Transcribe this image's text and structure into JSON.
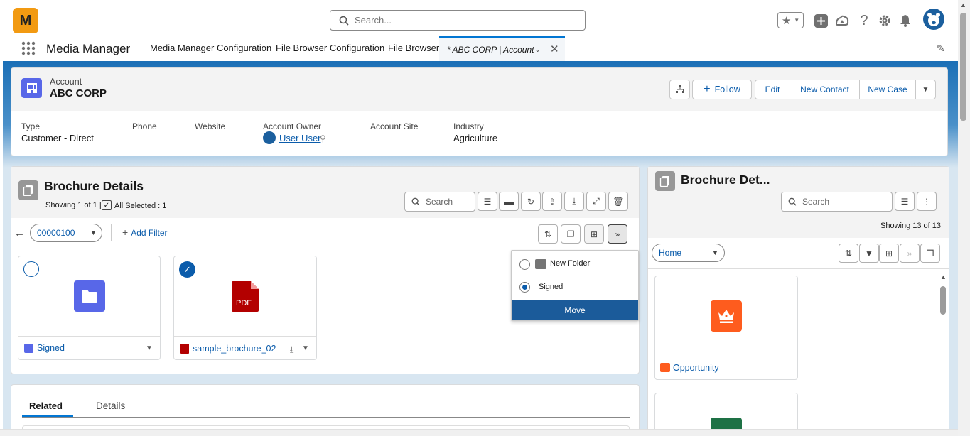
{
  "header": {
    "search_placeholder": "Search...",
    "logo_text": "M"
  },
  "nav": {
    "app_name": "Media Manager",
    "tabs": [
      "Media Manager Configuration",
      "File Browser Configuration",
      "File Browser"
    ],
    "active_tab": "* ABC CORP | Account"
  },
  "account": {
    "object_label": "Account",
    "name": "ABC CORP",
    "buttons": {
      "follow": "Follow",
      "edit": "Edit",
      "new_contact": "New Contact",
      "new_case": "New Case"
    },
    "fields": [
      {
        "label": "Type",
        "value": "Customer - Direct"
      },
      {
        "label": "Phone",
        "value": ""
      },
      {
        "label": "Website",
        "value": ""
      },
      {
        "label": "Account Owner",
        "value": "User User"
      },
      {
        "label": "Account Site",
        "value": ""
      },
      {
        "label": "Industry",
        "value": "Agriculture"
      }
    ]
  },
  "brochure_left": {
    "title": "Brochure Details",
    "showing": "Showing 1 of 1 |",
    "all_selected": "All Selected : 1",
    "search_placeholder": "Search",
    "folder_select": "00000100",
    "add_filter": "Add Filter",
    "tiles": [
      {
        "name": "Signed",
        "type": "folder",
        "selected": false
      },
      {
        "name": "sample_brochure_02",
        "type": "pdf",
        "selected": true,
        "badge": "PDF"
      }
    ]
  },
  "move_popup": {
    "options": [
      {
        "label": "New Folder",
        "checked": false
      },
      {
        "label": "Signed",
        "checked": true
      }
    ],
    "button": "Move"
  },
  "brochure_right": {
    "title": "Brochure Det...",
    "search_placeholder": "Search",
    "showing": "Showing 13 of 13",
    "folder_select": "Home",
    "tiles": [
      {
        "name": "Opportunity"
      }
    ]
  },
  "related": {
    "tabs": [
      "Related",
      "Details"
    ]
  },
  "colors": {
    "brand_blue": "#0176d3",
    "link": "#0b5cab",
    "move_button": "#1b5b9a",
    "account_icon": "#5867e8",
    "opportunity_icon": "#fe5c1e",
    "pdf_icon": "#b30000",
    "logo_bg": "#f29a12"
  }
}
